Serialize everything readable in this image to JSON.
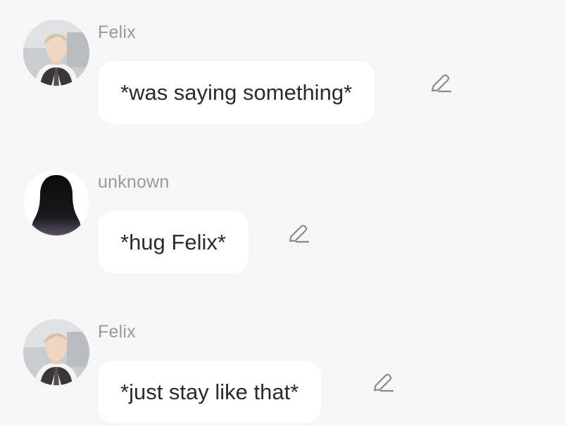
{
  "messages": [
    {
      "sender": "Felix",
      "text": "*was saying something*",
      "avatar": "photo-avatar",
      "action_icon": "pencil-edit-icon"
    },
    {
      "sender": "unknown",
      "text": "*hug Felix*",
      "avatar": "silhouette-avatar",
      "action_icon": "pencil-edit-icon"
    },
    {
      "sender": "Felix",
      "text": "*just stay like that*",
      "avatar": "photo-avatar",
      "action_icon": "pencil-edit-icon"
    }
  ],
  "colors": {
    "background": "#f6f6f6",
    "bubble": "#ffffff",
    "name_text": "#9a9a9a",
    "message_text": "#2b2b2b",
    "icon": "#8a8a8a"
  }
}
